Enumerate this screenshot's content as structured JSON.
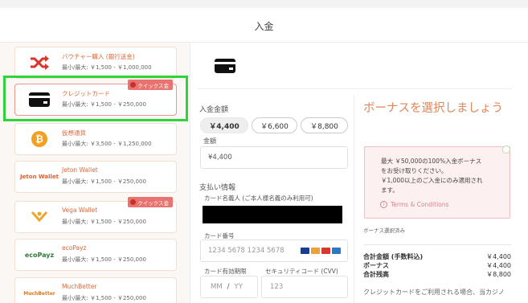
{
  "header": {
    "title": "入金"
  },
  "payment_methods": [
    {
      "name": "バウチャー購入 (銀行送金)",
      "limit": "最小/最大: ￥1,500 - ￥1,000,000",
      "icon": "shuffle-icon"
    },
    {
      "name": "クレジットカード",
      "limit": "最小/最大: ￥1,500 - ￥250,000",
      "icon": "credit-card-icon",
      "badge": "クイックス金"
    },
    {
      "name": "仮想通貨",
      "limit": "最小/最大: ￥3,500 - ￥1,250,000",
      "icon": "bitcoin-icon"
    },
    {
      "name": "Jeton Wallet",
      "limit": "最小/最大: ￥1,500 - ￥250,000",
      "icon": "jeton-logo",
      "logo_text": "Jeton Wallet"
    },
    {
      "name": "Vega Wallet",
      "limit": "最小/最大: ￥1,500 - ￥250,000",
      "icon": "vega-logo",
      "badge": "クイックス金"
    },
    {
      "name": "ecoPayz",
      "limit": "最小/最大: ￥1,500 - ￥250,000",
      "icon": "ecopayz-logo",
      "logo_text": "ecoPayz"
    },
    {
      "name": "MuchBetter",
      "limit": "最小/最大: ￥1,500 - ￥250,000",
      "icon": "muchbetter-logo",
      "logo_text": "MuchBetter"
    }
  ],
  "deposit": {
    "amount_label": "入金金額",
    "amounts": [
      "￥4,400",
      "￥6,600",
      "￥8,800"
    ],
    "selected_amount_index": 0,
    "custom_label": "金額",
    "custom_value": "¥4,400",
    "payment_info_label": "支払い情報",
    "cardholder_label": "カード名義人 (ご本人様名義のみ利用可)",
    "card_number_label": "カード番号",
    "card_number_placeholder": "1234 5678 1234 5678",
    "expiry_label": "カード有効期限",
    "expiry_mm": "MM",
    "expiry_sep": "/",
    "expiry_yy": "YY",
    "cvv_label": "セキュリティコード (CVV)",
    "cvv_placeholder": "123"
  },
  "bonus": {
    "title": "ボーナスを選択しましょう",
    "line1": "最大 ￥50,000の100%入金ボーナス",
    "line2": "をお受け取りください。",
    "line3": "￥1,000以上のご入金にのみ適用され",
    "line4": "ます。",
    "terms_label": "Terms & Conditions",
    "select_hint": "ボーナス選択済み"
  },
  "summary": {
    "rows": [
      {
        "label": "合計金額 (手数料込)",
        "value": "￥4,400"
      },
      {
        "label": "ボーナス",
        "value": "￥4,400"
      },
      {
        "label": "合計残高",
        "value": "￥8,800"
      }
    ],
    "note": "クレジットカードをご利用される場合、当カジノ"
  },
  "colors": {
    "accent": "#e0875a",
    "highlight": "#2fd43a",
    "badge": "#e9736e"
  }
}
